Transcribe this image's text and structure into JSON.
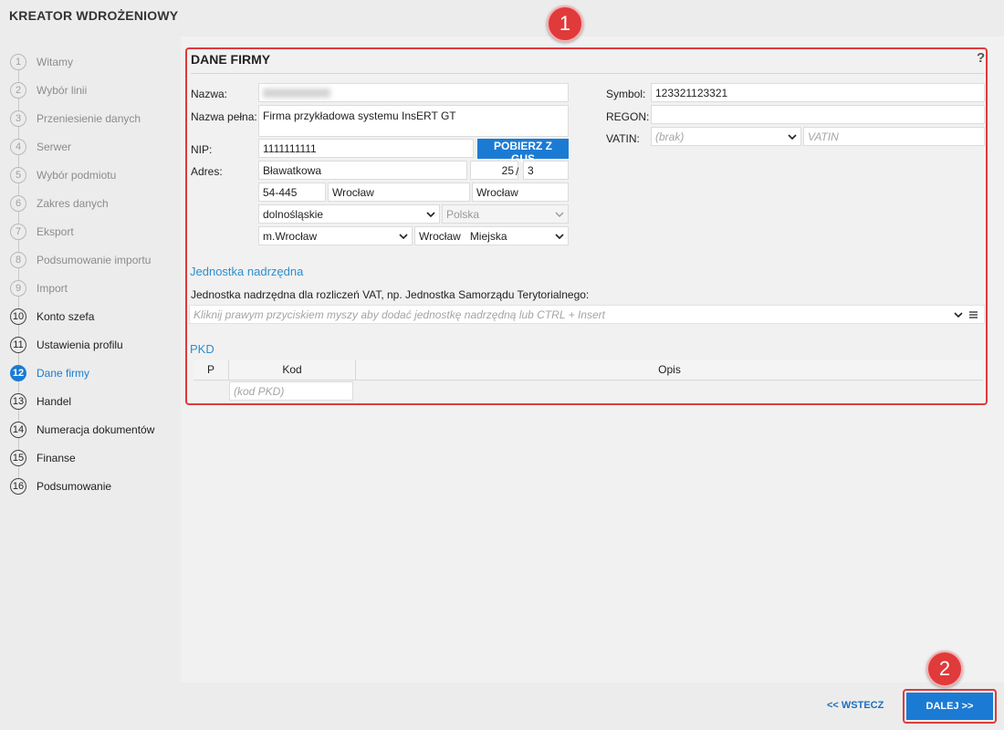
{
  "app_title": "KREATOR WDROŻENIOWY",
  "steps": [
    {
      "num": "1",
      "label": "Witamy"
    },
    {
      "num": "2",
      "label": "Wybór linii"
    },
    {
      "num": "3",
      "label": "Przeniesienie danych"
    },
    {
      "num": "4",
      "label": "Serwer"
    },
    {
      "num": "5",
      "label": "Wybór podmiotu"
    },
    {
      "num": "6",
      "label": "Zakres danych"
    },
    {
      "num": "7",
      "label": "Eksport"
    },
    {
      "num": "8",
      "label": "Podsumowanie importu"
    },
    {
      "num": "9",
      "label": "Import"
    },
    {
      "num": "10",
      "label": "Konto szefa"
    },
    {
      "num": "11",
      "label": "Ustawienia profilu"
    },
    {
      "num": "12",
      "label": "Dane firmy"
    },
    {
      "num": "13",
      "label": "Handel"
    },
    {
      "num": "14",
      "label": "Numeracja dokumentów"
    },
    {
      "num": "15",
      "label": "Finanse"
    },
    {
      "num": "16",
      "label": "Podsumowanie"
    }
  ],
  "annotations": {
    "badge1": "1",
    "badge2": "2"
  },
  "section": {
    "title": "DANE FIRMY",
    "help": "?"
  },
  "form": {
    "nazwa_label": "Nazwa:",
    "nazwa_pelna_label": "Nazwa pełna:",
    "nazwa_pelna_value": "Firma przykładowa systemu InsERT GT",
    "nip_label": "NIP:",
    "nip_value": "1111111111",
    "gus_button": "POBIERZ Z GUS",
    "adres_label": "Adres:",
    "street": "Bławatkowa",
    "house_no": "25",
    "slash": "/",
    "flat_no": "3",
    "postcode": "54-445",
    "city": "Wrocław",
    "post_office": "Wrocław",
    "voivodeship": "dolnośląskie",
    "country": "Polska",
    "county": "m.Wrocław",
    "commune": "Wrocław",
    "commune_type": "Miejska",
    "symbol_label": "Symbol:",
    "symbol_value": "123321123321",
    "regon_label": "REGON:",
    "regon_value": "",
    "vatin_label": "VATIN:",
    "vatin_select": "(brak)",
    "vatin_placeholder": "VATIN"
  },
  "parent_unit": {
    "heading": "Jednostka nadrzędna",
    "label": "Jednostka nadrzędna dla rozliczeń VAT, np. Jednostka Samorządu Terytorialnego:",
    "placeholder": "Kliknij prawym przyciskiem myszy aby dodać jednostkę nadrzędną lub CTRL + Insert"
  },
  "pkd": {
    "heading": "PKD",
    "columns": [
      "P",
      "Kod",
      "Opis"
    ],
    "code_placeholder": "(kod PKD)"
  },
  "footer": {
    "back": "<< WSTECZ",
    "next": "DALEJ >>"
  },
  "colors": {
    "accent": "#1b7bd4",
    "highlight": "#e03a3a"
  }
}
